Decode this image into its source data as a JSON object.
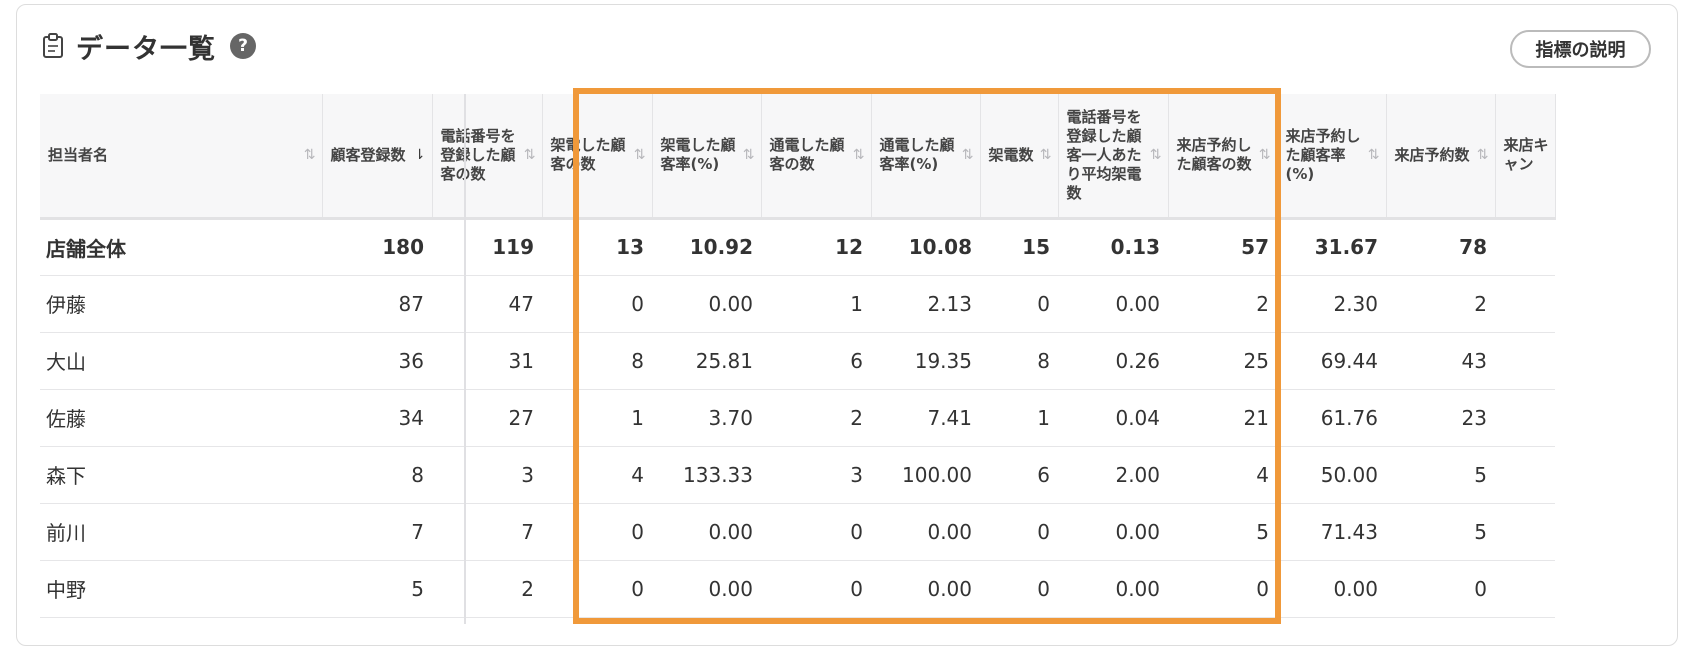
{
  "title": "データ一覧",
  "help_icon": "?",
  "explain_button": "指標の説明",
  "colors": {
    "highlight": "#f0993a"
  },
  "columns": [
    {
      "label": "担当者名",
      "sort": "⇅"
    },
    {
      "label": "顧客登録数",
      "sort": "⇂"
    },
    {
      "label": "電話番号を登録した顧客の数",
      "sort": "⇅"
    },
    {
      "label": "架電した顧客の数",
      "sort": "⇅"
    },
    {
      "label": "架電した顧客率(%)",
      "sort": "⇅"
    },
    {
      "label": "通電した顧客の数",
      "sort": "⇅"
    },
    {
      "label": "通電した顧客率(%)",
      "sort": "⇅"
    },
    {
      "label": "架電数",
      "sort": "⇅"
    },
    {
      "label": "電話番号を登録した顧客一人あたり平均架電数",
      "sort": "⇅"
    },
    {
      "label": "来店予約した顧客の数",
      "sort": "⇅"
    },
    {
      "label": "来店予約した顧客率(%)",
      "sort": "⇅"
    },
    {
      "label": "来店予約数",
      "sort": "⇅"
    },
    {
      "label": "来店キャン",
      "sort": ""
    }
  ],
  "rows": [
    {
      "name": "店舗全体",
      "values": [
        "180",
        "119",
        "13",
        "10.92",
        "12",
        "10.08",
        "15",
        "0.13",
        "57",
        "31.67",
        "78"
      ]
    },
    {
      "name": "伊藤",
      "values": [
        "87",
        "47",
        "0",
        "0.00",
        "1",
        "2.13",
        "0",
        "0.00",
        "2",
        "2.30",
        "2"
      ]
    },
    {
      "name": "大山",
      "values": [
        "36",
        "31",
        "8",
        "25.81",
        "6",
        "19.35",
        "8",
        "0.26",
        "25",
        "69.44",
        "43"
      ]
    },
    {
      "name": "佐藤",
      "values": [
        "34",
        "27",
        "1",
        "3.70",
        "2",
        "7.41",
        "1",
        "0.04",
        "21",
        "61.76",
        "23"
      ]
    },
    {
      "name": "森下",
      "values": [
        "8",
        "3",
        "4",
        "133.33",
        "3",
        "100.00",
        "6",
        "2.00",
        "4",
        "50.00",
        "5"
      ]
    },
    {
      "name": "前川",
      "values": [
        "7",
        "7",
        "0",
        "0.00",
        "0",
        "0.00",
        "0",
        "0.00",
        "5",
        "71.43",
        "5"
      ]
    },
    {
      "name": "中野",
      "values": [
        "5",
        "2",
        "0",
        "0.00",
        "0",
        "0.00",
        "0",
        "0.00",
        "0",
        "0.00",
        "0"
      ]
    }
  ]
}
